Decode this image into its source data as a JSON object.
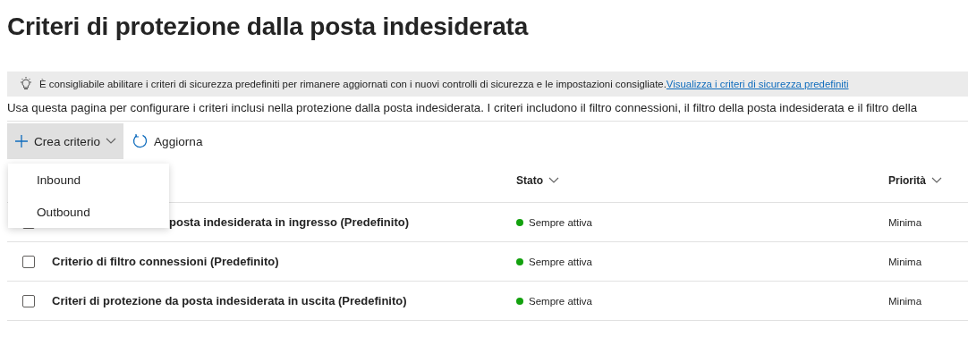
{
  "page": {
    "title": "Criteri di protezione dalla posta indesiderata"
  },
  "banner": {
    "text": "È consigliabile abilitare i criteri di sicurezza predefiniti per rimanere aggiornati con i nuovi controlli di sicurezza e le impostazioni consigliate.",
    "link": "Visualizza i criteri di sicurezza predefiniti"
  },
  "description": "Usa questa pagina per configurare i criteri inclusi nella protezione dalla posta indesiderata. I criteri includono il filtro connessioni, il filtro della posta indesiderata e il filtro della",
  "toolbar": {
    "buttons": [
      {
        "label": "Crea criterio",
        "kind": "create",
        "expanded": true
      },
      {
        "label": "Aggiorna",
        "kind": "refresh"
      }
    ]
  },
  "menu": {
    "items": [
      {
        "label": "Inbound"
      },
      {
        "label": "Outbound"
      }
    ]
  },
  "table": {
    "columns": [
      {
        "label": "Stato"
      },
      {
        "label": "Priorità"
      }
    ],
    "rows": [
      {
        "name": "posta indesiderata in ingresso (Predefinito)",
        "checked": false,
        "status": "Sempre attiva",
        "color": "#13a10e",
        "priority": "Minima"
      },
      {
        "name": "Criterio di filtro connessioni (Predefinito)",
        "checked": false,
        "status": "Sempre attiva",
        "color": "#13a10e",
        "priority": "Minima"
      },
      {
        "name": "Criteri di protezione da posta indesiderata in uscita (Predefinito)",
        "checked": false,
        "status": "Sempre attiva",
        "color": "#13a10e",
        "priority": "Minima"
      }
    ]
  }
}
